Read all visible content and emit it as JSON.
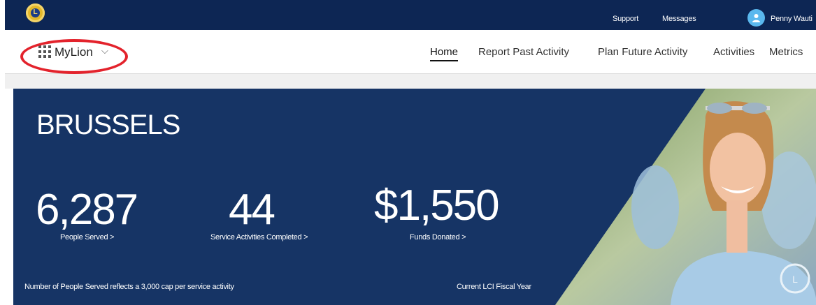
{
  "topbar": {
    "logo_letter": "L",
    "support_label": "Support",
    "messages_label": "Messages",
    "user_name": "Penny Wauti"
  },
  "nav": {
    "app_name": "MyLion",
    "app_caret": "⌵",
    "items": [
      {
        "label": "Home",
        "active": true
      },
      {
        "label": "Report Past Activity"
      },
      {
        "label": "Plan Future Activity"
      },
      {
        "label": "Activities"
      },
      {
        "label": "Metrics"
      }
    ]
  },
  "hero": {
    "city": "BRUSSELS",
    "stats": [
      {
        "value": "6,287",
        "label": "People Served >"
      },
      {
        "value": "44",
        "label": "Service Activities Completed >"
      },
      {
        "value": "$1,550",
        "label": "Funds Donated >"
      }
    ],
    "footnote": "Number of People Served reflects a 3,000 cap per service activity",
    "fiscal_note": "Current LCI Fiscal Year"
  },
  "colors": {
    "topbar_bg": "#0d2654",
    "hero_bg": "#163465",
    "highlight_ring": "#e3232c",
    "avatar": "#5ab8ee"
  },
  "icons": [
    "lions-logo",
    "user-icon",
    "app-grid-icon",
    "chevron-down-icon"
  ]
}
